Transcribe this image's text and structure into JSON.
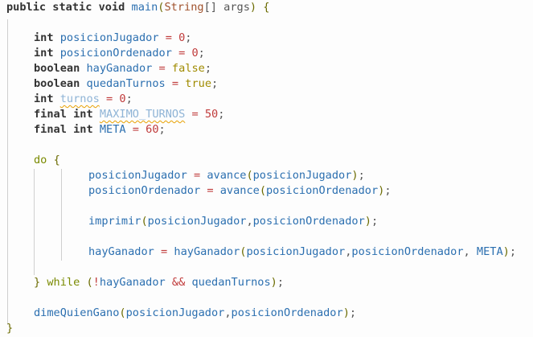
{
  "code": {
    "public": "public",
    "static": "static",
    "void": "void",
    "main": "main",
    "lparen": "(",
    "String": "String",
    "arr": "[]",
    "args": "args",
    "rparen": ")",
    "lbrace": "{",
    "int": "int",
    "boolean": "boolean",
    "final": "final",
    "eq": "=",
    "semi": ";",
    "comma": ",",
    "posJ": "posicionJugador",
    "posO": "posicionOrdenador",
    "hayGanador": "hayGanador",
    "quedanTurnos": "quedanTurnos",
    "turnos": "turnos",
    "maxTurnos": "MAXIMO_TURNOS",
    "meta": "META",
    "zero": "0",
    "fifty": "50",
    "sixty": "60",
    "false": "false",
    "true": "true",
    "do": "do",
    "while": "while",
    "rbrace": "}",
    "avance": "avance",
    "imprimir": "imprimir",
    "dimeQuienGano": "dimeQuienGano",
    "not": "!",
    "and": "&&"
  }
}
